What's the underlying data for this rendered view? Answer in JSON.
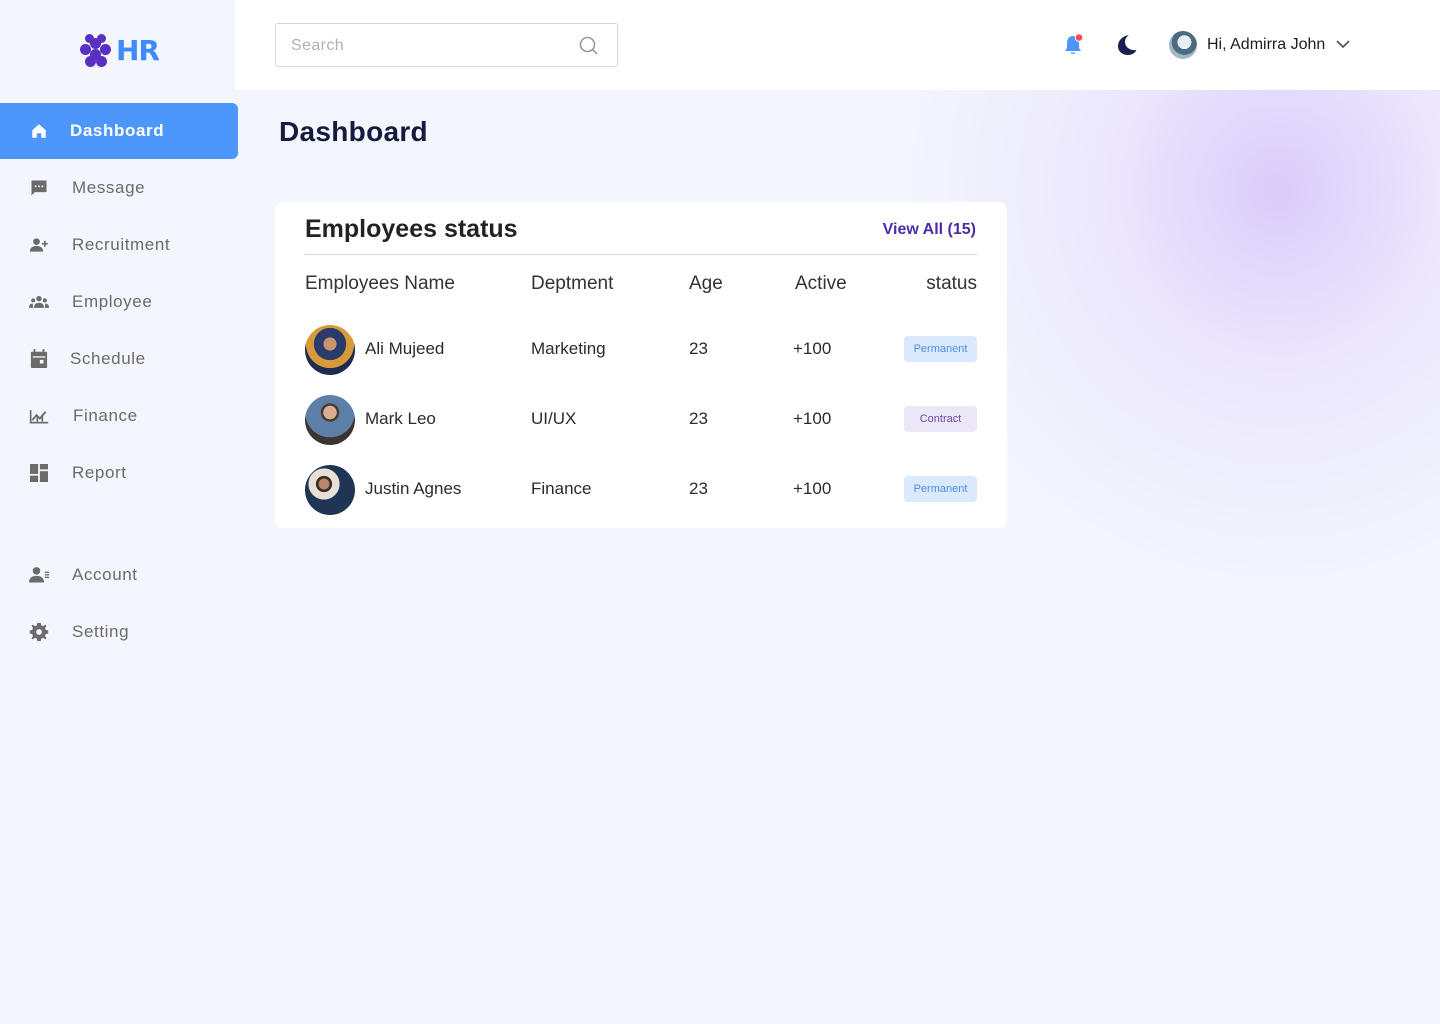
{
  "brand": {
    "name": "HR"
  },
  "sidebar": {
    "items": [
      {
        "label": "Dashboard",
        "icon": "home-icon",
        "active": true
      },
      {
        "label": "Message",
        "icon": "message-icon"
      },
      {
        "label": "Recruitment",
        "icon": "person-add-icon"
      },
      {
        "label": "Employee",
        "icon": "people-icon"
      },
      {
        "label": "Schedule",
        "icon": "calendar-icon"
      },
      {
        "label": "Finance",
        "icon": "chart-icon"
      },
      {
        "label": "Report",
        "icon": "dashboard-grid-icon"
      }
    ],
    "bottom_items": [
      {
        "label": "Account",
        "icon": "account-icon"
      },
      {
        "label": "Setting",
        "icon": "gear-icon"
      }
    ]
  },
  "header": {
    "search_placeholder": "Search",
    "greeting": "Hi, Admirra John"
  },
  "page": {
    "title": "Dashboard"
  },
  "employees_card": {
    "title": "Employees status",
    "view_all": "View All (15)",
    "columns": [
      "Employees Name",
      "Deptment",
      "Age",
      "Active",
      "status"
    ],
    "rows": [
      {
        "name": "Ali Mujeed",
        "department": "Marketing",
        "age": "23",
        "active": "+100",
        "status": "Permanent"
      },
      {
        "name": "Mark Leo",
        "department": "UI/UX",
        "age": "23",
        "active": "+100",
        "status": "Contract"
      },
      {
        "name": "Justin Agnes",
        "department": "Finance",
        "age": "23",
        "active": "+100",
        "status": "Permanent"
      }
    ]
  },
  "colors": {
    "accent": "#4c96fc",
    "brand_purple": "#5a2fc2",
    "permanent_badge": "#dbe9fd",
    "contract_badge": "#ebe7f6",
    "notification_dot": "#ff4d4d"
  }
}
